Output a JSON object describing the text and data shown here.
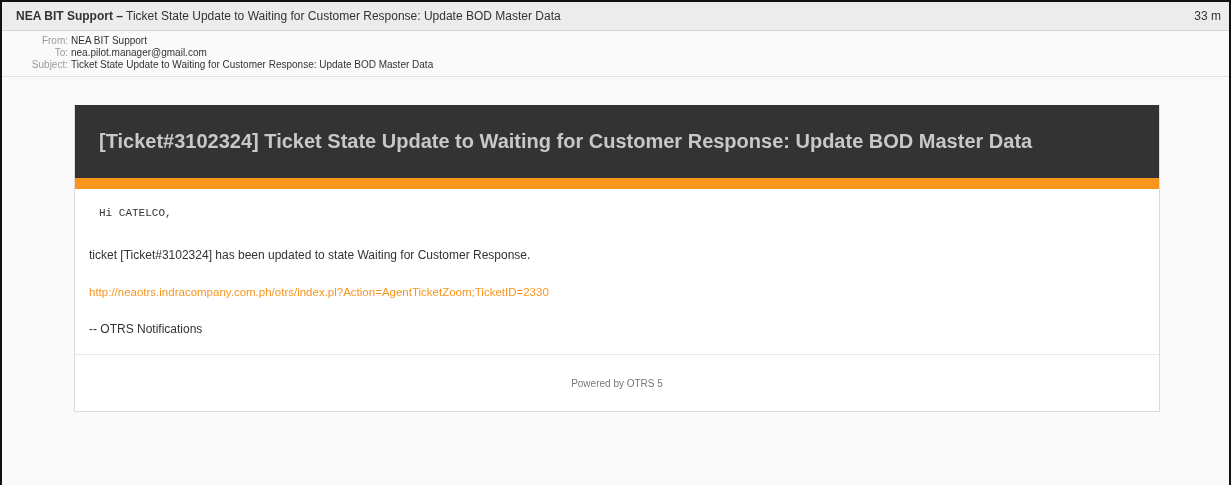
{
  "message_header": {
    "subject_line": "**NEA BIT Support –** Ticket State Update to Waiting for Customer Response: Update BOD Master Data",
    "age": "33 m",
    "fields": [
      {
        "label": "From:",
        "value": "NEA BIT Support"
      },
      {
        "label": "To:",
        "value": "nea.pilot.manager@gmail.com"
      },
      {
        "label": "Subject:",
        "value": "Ticket State Update to Waiting for Customer Response: Update BOD Master Data"
      }
    ]
  },
  "email": {
    "banner_title": "[Ticket#3102324] Ticket State Update to Waiting for Customer Response: Update BOD Master Data",
    "greeting": "Hi CATELCO,",
    "body": "ticket [Ticket#3102324] has been updated to state Waiting for Customer Response.",
    "link": "http://neaotrs.indracompany.com.ph/otrs/index.pl?Action=AgentTicketZoom;TicketID=2330",
    "signature": "-- OTRS Notifications",
    "footer": "Powered by OTRS 5"
  }
}
